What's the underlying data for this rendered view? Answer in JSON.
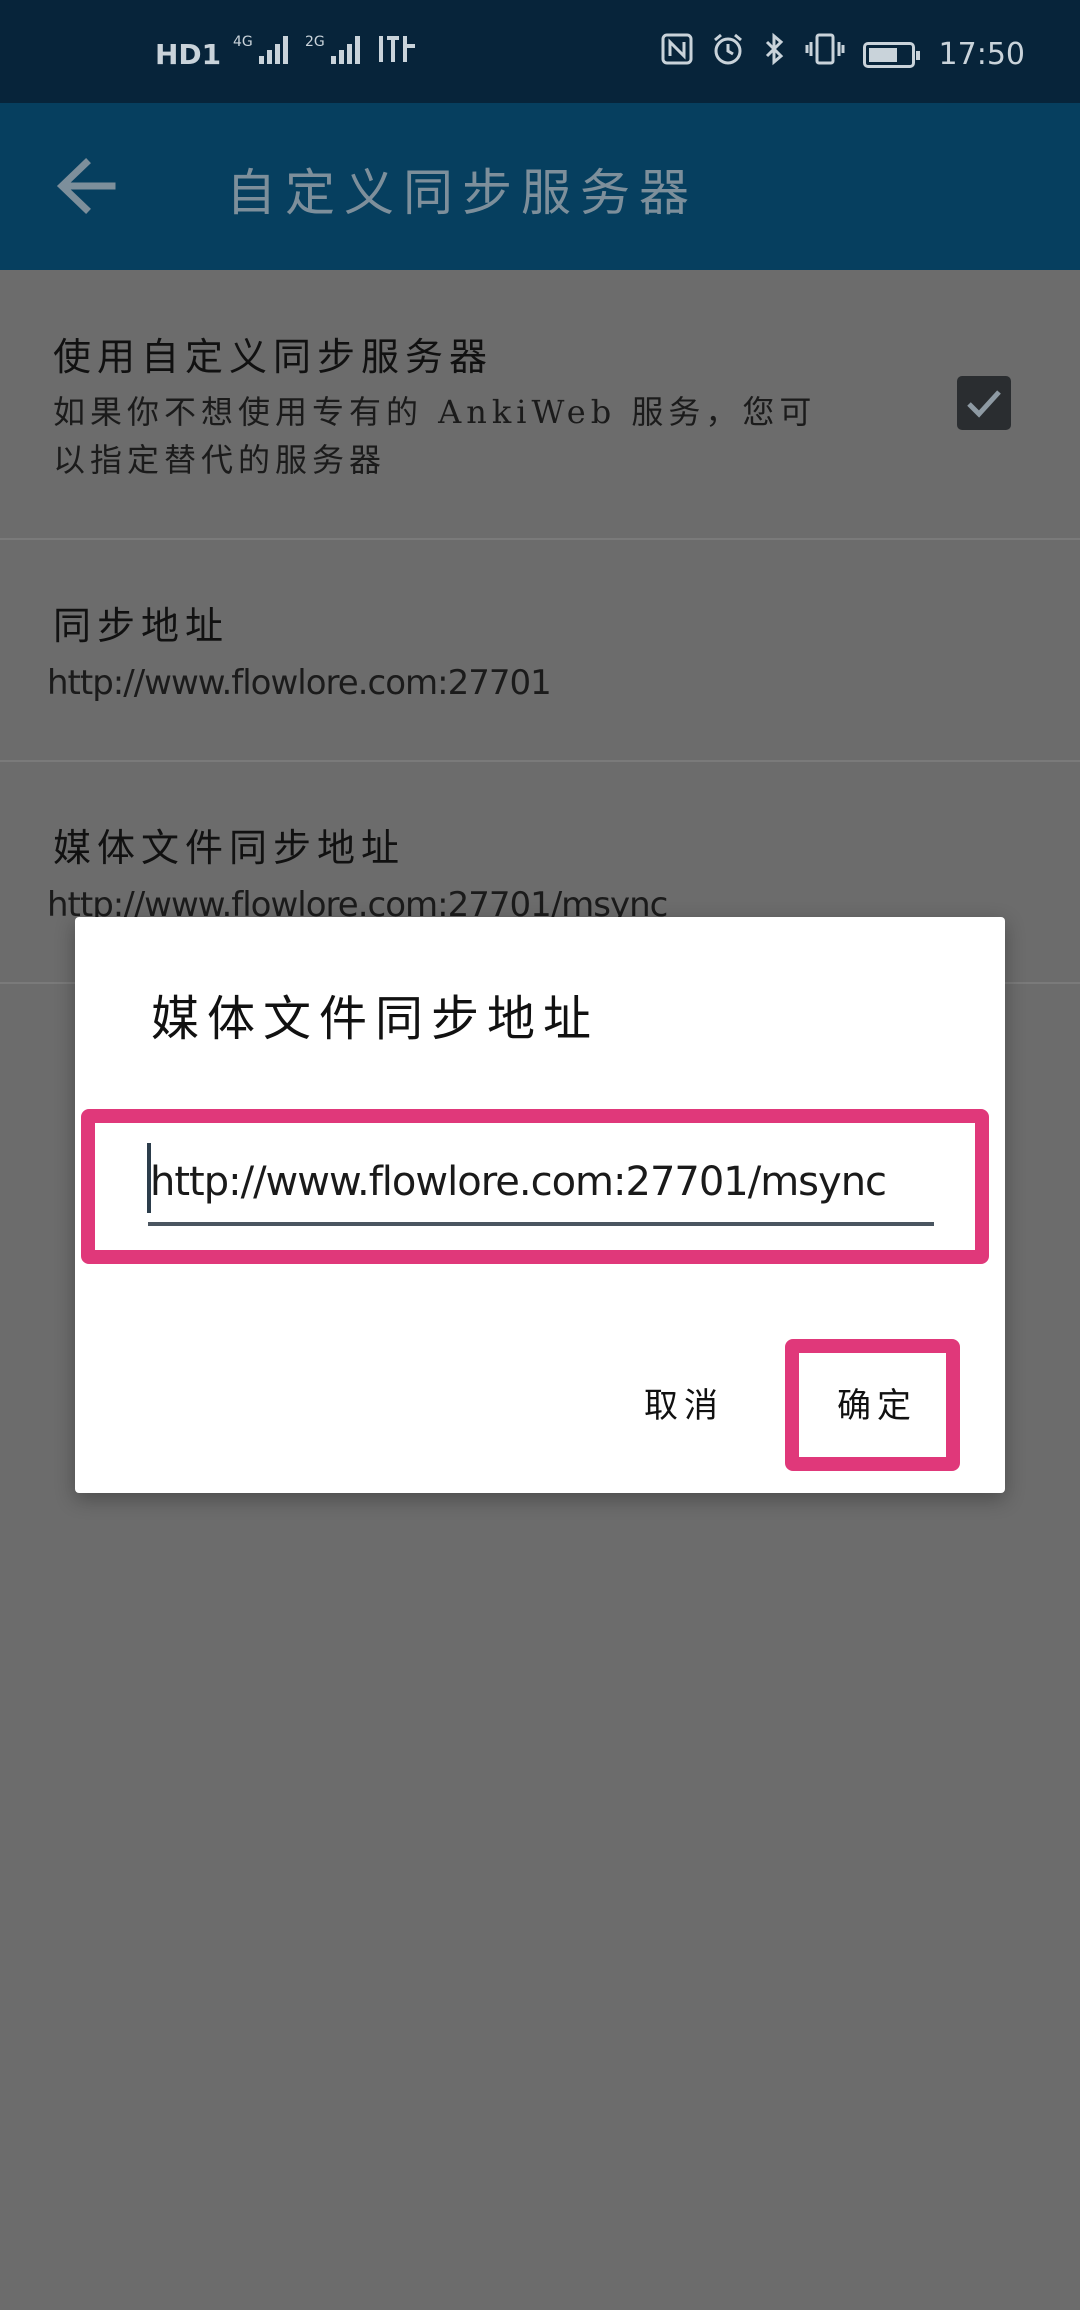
{
  "status_bar": {
    "left_icons": [
      "HD1",
      "4G",
      "2G",
      "signal"
    ],
    "time": "17:50"
  },
  "toolbar": {
    "title": "自定义同步服务器"
  },
  "prefs": {
    "use_custom": {
      "title": "使用自定义同步服务器",
      "summary_line1": "如果你不想使用专有的 AnkiWeb 服务，您可",
      "summary_line2": "以指定替代的服务器",
      "checked": true
    },
    "sync_url": {
      "title": "同步地址",
      "value": "http://www.flowlore.com:27701"
    },
    "media_sync_url": {
      "title": "媒体文件同步地址",
      "value": "http://www.flowlore.com:27701/msync"
    }
  },
  "dialog": {
    "title": "媒体文件同步地址",
    "input_value": "http://www.flowlore.com:27701/msync",
    "cancel_label": "取消",
    "ok_label": "确定",
    "highlight_color": "#e0387a"
  }
}
